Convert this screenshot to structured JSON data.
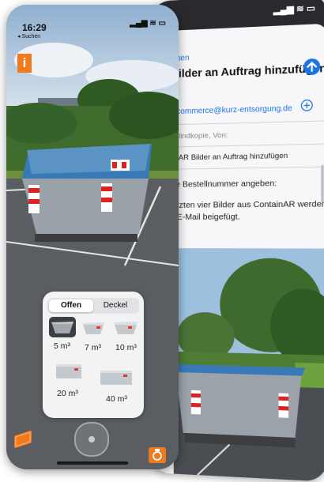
{
  "mail": {
    "status_icons": "▂▄▆ ≋ ▭",
    "title_tail": "ilder",
    "back_label": "chen",
    "subject_heading": "Bilder an Auftrag hinzufügen",
    "to_address": "ecommerce@kurz-entsorgung.de",
    "cc_label": "Blindkopie, Von:",
    "subject_line": "AR Bilder an Auftrag hinzufügen",
    "body_line1": "ie Bestellnummer angeben:",
    "body_line2": "tzten vier Bilder aus ContainAR werden",
    "body_line3": "E-Mail beigefügt."
  },
  "ar": {
    "time": "16:29",
    "back_label": "◂ Suchen",
    "status_icons": "▂▄▆ ≋ ▭",
    "info_logo_letter": "i",
    "segment_open": "Offen",
    "segment_lid": "Deckel",
    "sizes": [
      {
        "label": "5 m³"
      },
      {
        "label": "7 m³"
      },
      {
        "label": "10 m³"
      },
      {
        "label": "20 m³"
      },
      {
        "label": "40 m³"
      }
    ],
    "colors": {
      "accent_orange": "#f07a1e",
      "container_blue": "#3a79b8",
      "container_grey": "#9aa1a8",
      "mail_blue": "#1a73e8"
    }
  }
}
